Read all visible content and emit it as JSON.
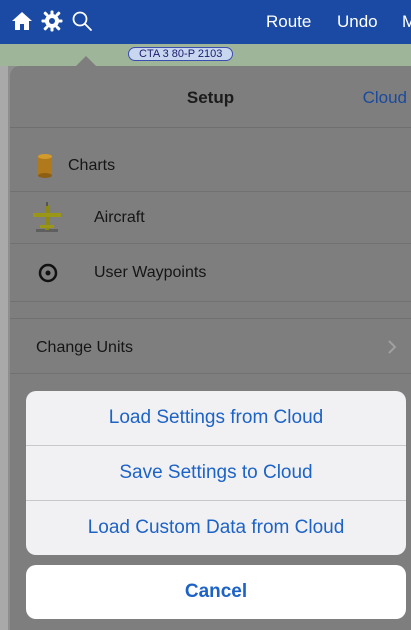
{
  "topbar": {
    "home_icon": "home-icon",
    "settings_icon": "gear-icon",
    "search_icon": "search-icon",
    "route_label": "Route",
    "undo_label": "Undo",
    "overflow_label": "M"
  },
  "map": {
    "label_text": "CTA 3 80-P 2103"
  },
  "setup": {
    "title": "Setup",
    "cloud_label": "Cloud",
    "items": [
      {
        "label": "Charts",
        "icon": "database-icon"
      },
      {
        "label": "Aircraft",
        "icon": "airplane-icon"
      },
      {
        "label": "User Waypoints",
        "icon": "waypoint-icon"
      },
      {
        "label": "Change Units",
        "icon": "chevron-right-icon"
      }
    ]
  },
  "action_sheet": {
    "load_settings": "Load Settings from Cloud",
    "save_settings": "Save Settings to Cloud",
    "load_custom": "Load Custom Data from Cloud",
    "cancel": "Cancel"
  },
  "colors": {
    "nav_bar": "#1a4aa3",
    "action_text": "#1d63c6",
    "dim_overlay": "#7e7e7e"
  }
}
